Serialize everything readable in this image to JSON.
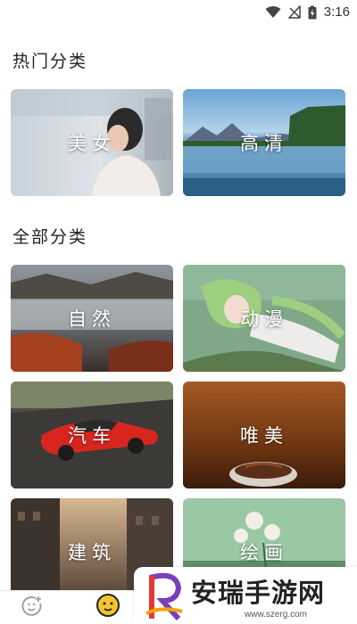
{
  "status_bar": {
    "time": "3:16",
    "icons": [
      "wifi-icon",
      "no-signal-icon",
      "battery-charging-icon"
    ]
  },
  "hot_section": {
    "title": "热门分类",
    "items": [
      {
        "label": "美女",
        "scene": "portrait-photo"
      },
      {
        "label": "高清",
        "scene": "mountain-lake"
      }
    ]
  },
  "all_section": {
    "title": "全部分类",
    "items": [
      {
        "label": "自然",
        "scene": "misty-autumn-valley"
      },
      {
        "label": "动漫",
        "scene": "anime-character"
      },
      {
        "label": "汽车",
        "scene": "red-sports-car"
      },
      {
        "label": "唯美",
        "scene": "coffee-cup"
      },
      {
        "label": "建筑",
        "scene": "city-street"
      },
      {
        "label": "绘画",
        "scene": "flower-painting"
      }
    ]
  },
  "bottom_nav": {
    "icons": [
      "add-face-icon",
      "home-face-icon"
    ]
  },
  "watermark": {
    "title": "安瑞手游网",
    "url": "www.szerg.com"
  },
  "colors": {
    "accent": "#f4c430",
    "watermark_logo_purple": "#7b3fb8",
    "watermark_logo_red": "#e53935"
  }
}
